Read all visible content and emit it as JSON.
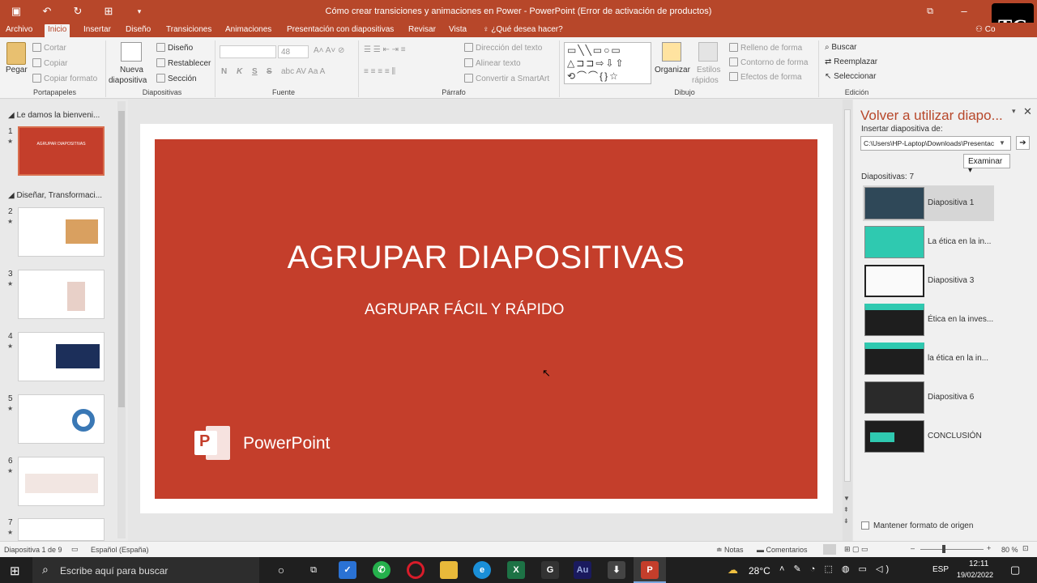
{
  "window": {
    "title": "Cómo crear transiciones y animaciones en Power - PowerPoint (Error de activación de productos)",
    "logo_text": "TC"
  },
  "tabs": [
    "Archivo",
    "Inicio",
    "Insertar",
    "Diseño",
    "Transiciones",
    "Animaciones",
    "Presentación con diapositivas",
    "Revisar",
    "Vista"
  ],
  "tell_me": "¿Qué desea hacer?",
  "account": "Co",
  "ribbon": {
    "portapapeles": {
      "paste": "Pegar",
      "cut": "Cortar",
      "copy": "Copiar",
      "format": "Copiar formato",
      "group": "Portapapeles"
    },
    "diapositivas": {
      "new": "Nueva",
      "new2": "diapositiva",
      "layout": "Diseño",
      "reset": "Restablecer",
      "section": "Sección",
      "group": "Diapositivas"
    },
    "fuente": {
      "size": "48",
      "bold": "N",
      "italic": "K",
      "underline": "S",
      "strike": "S",
      "group": "Fuente"
    },
    "parrafo": {
      "dir": "Dirección del texto",
      "align": "Alinear texto",
      "smartart": "Convertir a SmartArt",
      "group": "Párrafo"
    },
    "dibujo": {
      "arrange": "Organizar",
      "styles": "Estilos",
      "styles2": "rápidos",
      "fill": "Relleno de forma",
      "outline": "Contorno de forma",
      "effects": "Efectos de forma",
      "group": "Dibujo"
    },
    "edicion": {
      "find": "Buscar",
      "replace": "Reemplazar",
      "select": "Seleccionar",
      "group": "Edición"
    }
  },
  "thumbs": {
    "section1": "Le damos la bienveni...",
    "section2": "Diseñar, Transformaci...",
    "slide1_title": "AGRUPAR DIAPOSITIVAS",
    "numbers": [
      "1",
      "2",
      "3",
      "4",
      "5",
      "6",
      "7"
    ]
  },
  "slide": {
    "title": "AGRUPAR DIAPOSITIVAS",
    "subtitle": "AGRUPAR FÁCIL Y RÁPIDO",
    "brand": "PowerPoint",
    "brand_letter": "P",
    "bg_color": "#c43e2b"
  },
  "reuse": {
    "title": "Volver a utilizar diapo...",
    "insert_label": "Insertar diapositiva de:",
    "path": "C:\\Users\\HP-Laptop\\Downloads\\Presentac",
    "browse": "Examinar",
    "count": "Diapositivas: 7",
    "items": [
      "Diapositiva 1",
      "La ética en la in...",
      "Diapositiva 3",
      "Ética en la inves...",
      "la ética en la in...",
      "Diapositiva 6",
      "CONCLUSIÓN"
    ],
    "keep_format": "Mantener formato de origen"
  },
  "status": {
    "slide": "Diapositiva 1 de 9",
    "lang": "Español (España)",
    "notes": "Notas",
    "comments": "Comentarios",
    "zoom": "80 %"
  },
  "taskbar": {
    "search": "Escribe aquí para buscar",
    "temp": "28°C",
    "lang": "ESP",
    "time": "12:11",
    "date": "19/02/2022"
  }
}
